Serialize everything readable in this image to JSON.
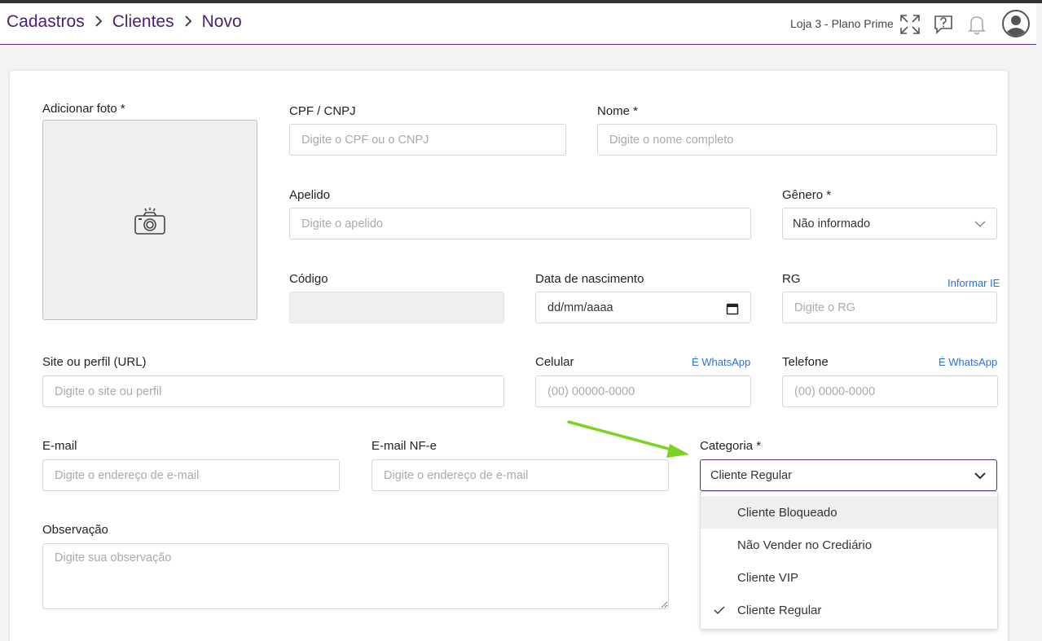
{
  "header": {
    "breadcrumb": [
      "Cadastros",
      "Clientes",
      "Novo"
    ],
    "store": "Loja 3 - Plano Prime",
    "icons": [
      "expand-icon",
      "help-chat-icon",
      "bell-icon",
      "user-avatar-icon"
    ]
  },
  "form": {
    "photo": {
      "label": "Adicionar foto *"
    },
    "cpf": {
      "label": "CPF / CNPJ",
      "placeholder": "Digite o CPF ou o CNPJ"
    },
    "nome": {
      "label": "Nome *",
      "placeholder": "Digite o nome completo"
    },
    "apelido": {
      "label": "Apelido",
      "placeholder": "Digite o apelido"
    },
    "genero": {
      "label": "Gênero *",
      "value": "Não informado"
    },
    "codigo": {
      "label": "Código",
      "value": ""
    },
    "nascimento": {
      "label": "Data de nascimento",
      "placeholder": "dd/mm/aaaa"
    },
    "rg": {
      "label": "RG",
      "link": "Informar IE",
      "placeholder": "Digite o RG"
    },
    "site": {
      "label": "Site ou perfil (URL)",
      "placeholder": "Digite o site ou perfil"
    },
    "celular": {
      "label": "Celular",
      "link": "É WhatsApp",
      "placeholder": "(00) 00000-0000"
    },
    "telefone": {
      "label": "Telefone",
      "link": "É WhatsApp",
      "placeholder": "(00) 0000-0000"
    },
    "email": {
      "label": "E-mail",
      "placeholder": "Digite o endereço de e-mail"
    },
    "email_nfe": {
      "label": "E-mail NF-e",
      "placeholder": "Digite o endereço de e-mail"
    },
    "categoria": {
      "label": "Categoria *",
      "value": "Cliente Regular",
      "options": [
        "Cliente Bloqueado",
        "Não Vender no Crediário",
        "Cliente VIP",
        "Cliente Regular"
      ],
      "selected_index": 3,
      "hover_index": 0
    },
    "observacao": {
      "label": "Observação",
      "placeholder": "Digite sua observação"
    }
  },
  "colors": {
    "brand": "#4a2070",
    "accent_border": "#5b2a86",
    "link": "#2f6fd8",
    "annotation_arrow": "#7ad31e"
  }
}
